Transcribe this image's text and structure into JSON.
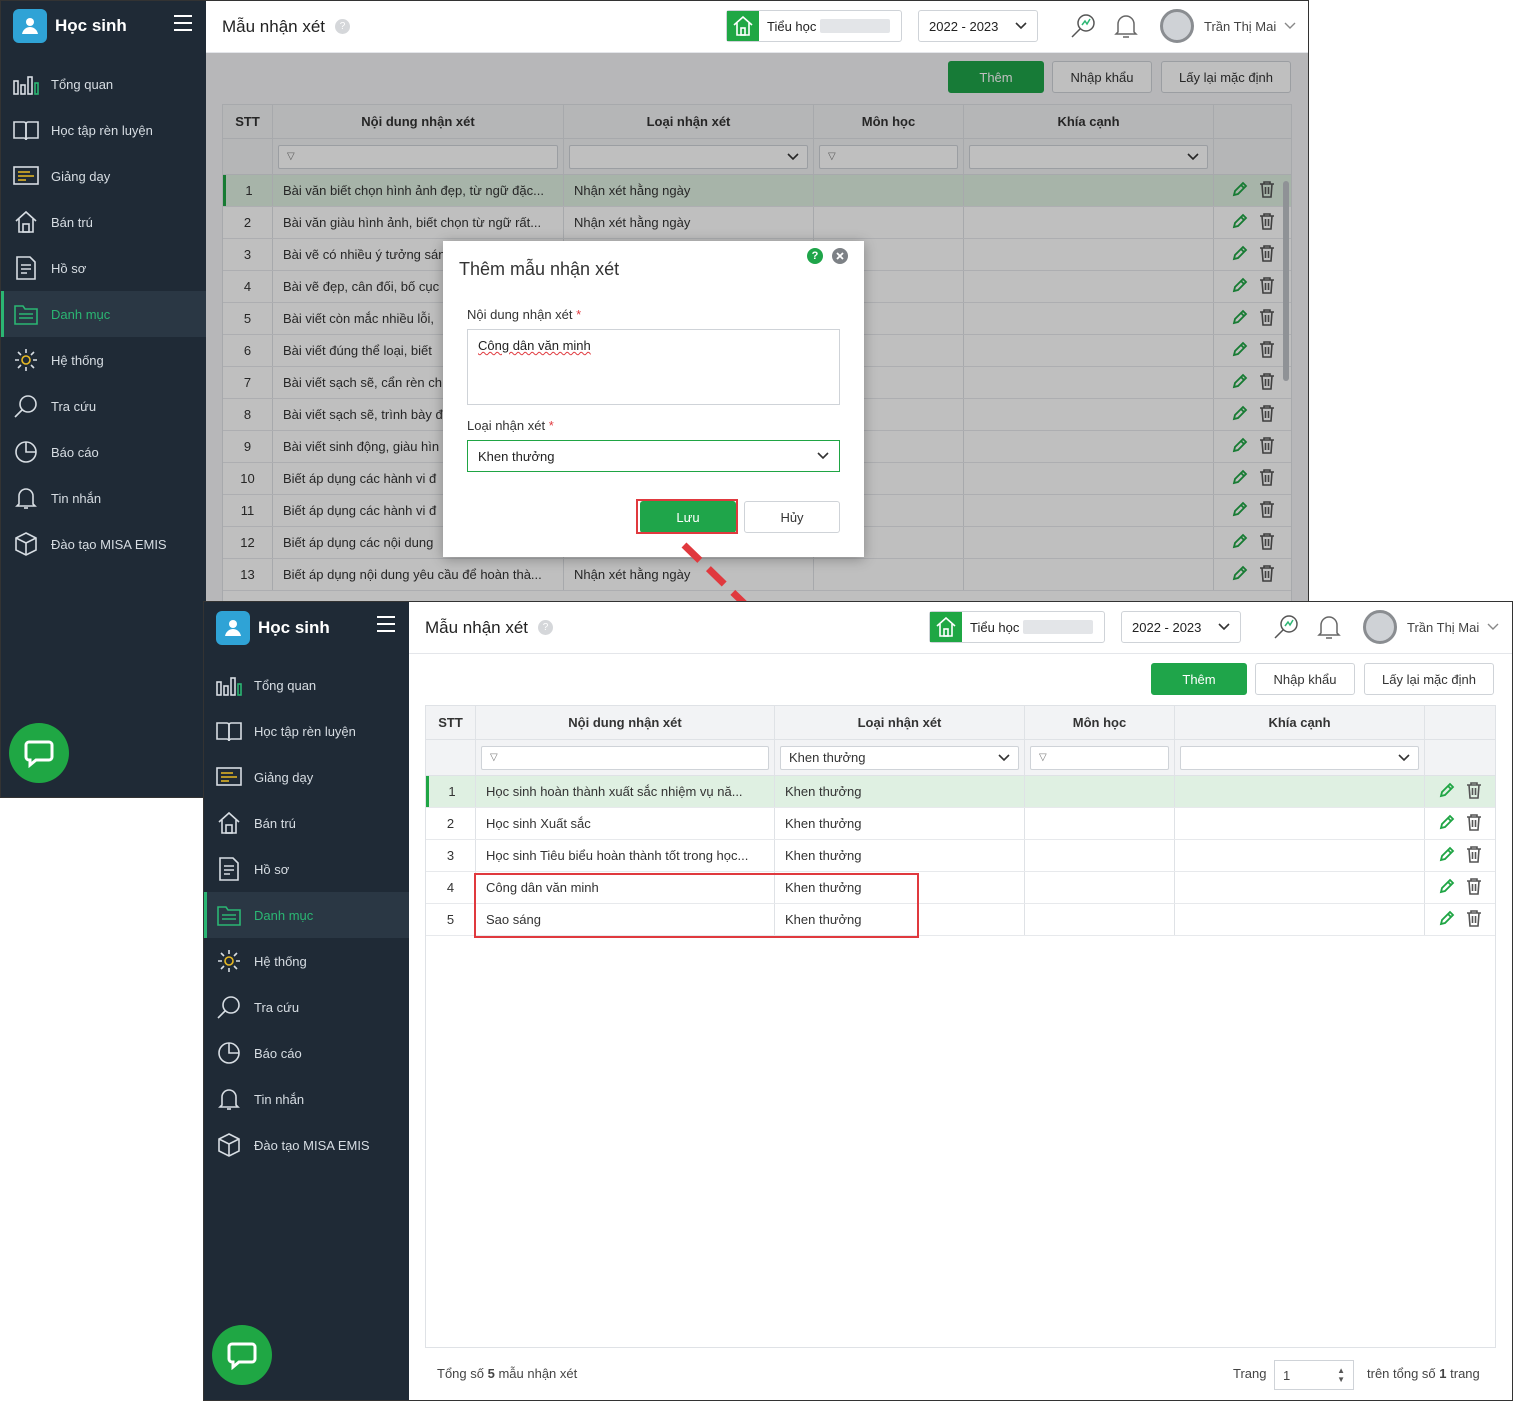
{
  "app": {
    "name": "Học sinh"
  },
  "sidebar": {
    "items": [
      {
        "label": "Tổng quan",
        "icon": "chart-icon"
      },
      {
        "label": "Học tập rèn luyện",
        "icon": "book-icon"
      },
      {
        "label": "Giảng dạy",
        "icon": "board-icon"
      },
      {
        "label": "Bán trú",
        "icon": "home-icon"
      },
      {
        "label": "Hồ sơ",
        "icon": "document-icon"
      },
      {
        "label": "Danh mục",
        "icon": "folder-icon"
      },
      {
        "label": "Hệ thống",
        "icon": "gear-icon"
      },
      {
        "label": "Tra cứu",
        "icon": "magnifier-icon"
      },
      {
        "label": "Báo cáo",
        "icon": "pie-icon"
      },
      {
        "label": "Tin nhắn",
        "icon": "bell-icon"
      },
      {
        "label": "Đào tạo MISA EMIS",
        "icon": "box-icon"
      }
    ],
    "active": "Danh mục"
  },
  "header": {
    "title": "Mẫu nhận xét",
    "help": "?",
    "school": "Tiểu học",
    "year": "2022 - 2023",
    "user": "Trần Thị Mai"
  },
  "toolbar": {
    "add": "Thêm",
    "import": "Nhập khẩu",
    "reset": "Lấy lại mặc định"
  },
  "columns": {
    "stt": "STT",
    "content": "Nội dung nhận xét",
    "type": "Loại nhận xét",
    "subject": "Môn học",
    "aspect": "Khía cạnh"
  },
  "grid1": {
    "rows": [
      {
        "stt": "1",
        "content": "Bài văn biết chọn hình ảnh đẹp, từ ngữ đặc...",
        "type": "Nhận xét hằng ngày"
      },
      {
        "stt": "2",
        "content": "Bài văn giàu hình ảnh, biết chọn từ ngữ rất...",
        "type": "Nhận xét hằng ngày"
      },
      {
        "stt": "3",
        "content": "Bài vẽ có nhiều ý tưởng sán",
        "type": ""
      },
      {
        "stt": "4",
        "content": "Bài vẽ đẹp, cân đối, bố cục",
        "type": ""
      },
      {
        "stt": "5",
        "content": "Bài viết còn mắc nhiều lỗi,",
        "type": ""
      },
      {
        "stt": "6",
        "content": "Bài viết đúng thể loại, biết",
        "type": ""
      },
      {
        "stt": "7",
        "content": "Bài viết sạch sẽ, cẩn rèn ch",
        "type": ""
      },
      {
        "stt": "8",
        "content": "Bài viết sạch sẽ, trình bày đ",
        "type": ""
      },
      {
        "stt": "9",
        "content": "Bài viết sinh động, giàu hìn",
        "type": ""
      },
      {
        "stt": "10",
        "content": "Biết áp dụng các hành vi đ",
        "type": ""
      },
      {
        "stt": "11",
        "content": "Biết áp dụng các hành vi đ",
        "type": ""
      },
      {
        "stt": "12",
        "content": "Biết áp dụng các nội dung",
        "type": ""
      },
      {
        "stt": "13",
        "content": "Biết áp dụng nội dung yêu cầu để hoàn thà...",
        "type": "Nhận xét hằng ngày"
      }
    ]
  },
  "dialog": {
    "title": "Thêm mẫu nhận xét",
    "help": "?",
    "content_label": "Nội dung nhận xét",
    "content_value": "Công dân văn minh",
    "type_label": "Loại nhận xét",
    "type_value": "Khen thưởng",
    "required": "*",
    "save": "Lưu",
    "cancel": "Hủy"
  },
  "grid2": {
    "filter_type": "Khen thưởng",
    "rows": [
      {
        "stt": "1",
        "content": "Học sinh hoàn thành xuất sắc nhiệm vụ nă...",
        "type": "Khen thưởng"
      },
      {
        "stt": "2",
        "content": "Học sinh Xuất sắc",
        "type": "Khen thưởng"
      },
      {
        "stt": "3",
        "content": "Học sinh Tiêu biểu hoàn thành tốt trong học...",
        "type": "Khen thưởng"
      },
      {
        "stt": "4",
        "content": "Công dân văn minh",
        "type": "Khen thưởng"
      },
      {
        "stt": "5",
        "content": "Sao sáng",
        "type": "Khen thưởng"
      }
    ]
  },
  "footer": {
    "total_prefix": "Tổng số",
    "total": "5",
    "total_suffix": "mẫu nhận xét",
    "page_label": "Trang",
    "page": "1",
    "pages_prefix": "trên tổng số",
    "pages": "1",
    "pages_suffix": "trang"
  },
  "colors": {
    "accent": "#1fa54a",
    "sidebar": "#1f2a36",
    "highlight": "#e0393e"
  }
}
